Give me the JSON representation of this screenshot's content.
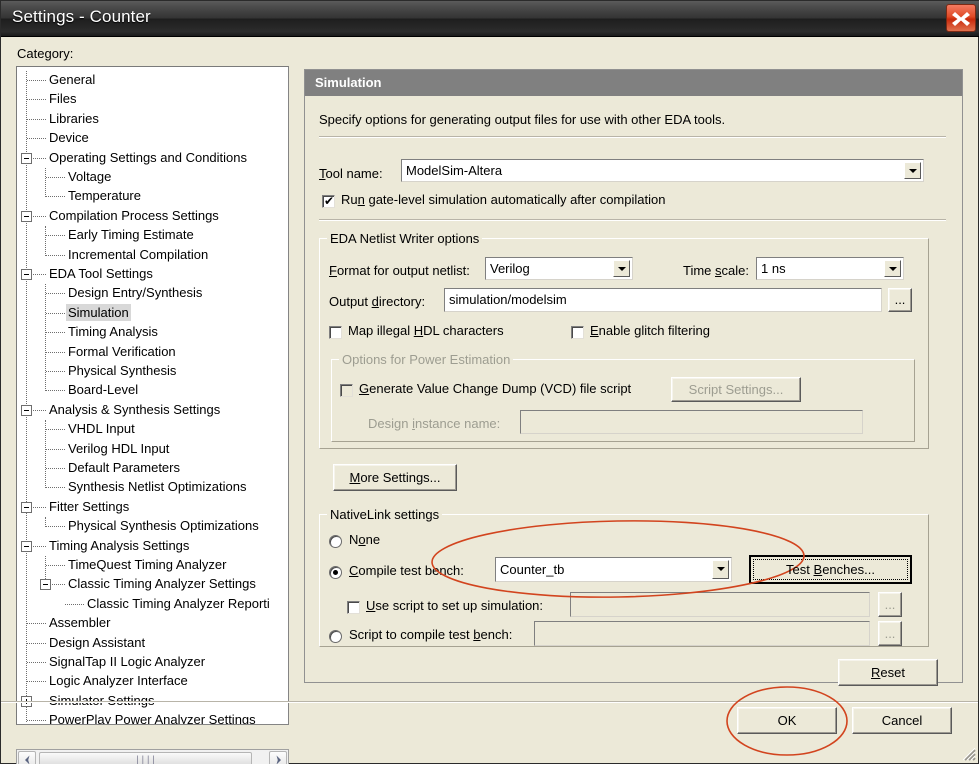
{
  "window": {
    "title": "Settings - Counter",
    "close_icon": "close-icon"
  },
  "sidebar": {
    "label": "Category:",
    "items": [
      {
        "label": "General",
        "depth": 1,
        "expander": null,
        "selected": false
      },
      {
        "label": "Files",
        "depth": 1,
        "expander": null,
        "selected": false
      },
      {
        "label": "Libraries",
        "depth": 1,
        "expander": null,
        "selected": false
      },
      {
        "label": "Device",
        "depth": 1,
        "expander": null,
        "selected": false
      },
      {
        "label": "Operating Settings and Conditions",
        "depth": 1,
        "expander": "minus",
        "selected": false
      },
      {
        "label": "Voltage",
        "depth": 2,
        "expander": null,
        "selected": false
      },
      {
        "label": "Temperature",
        "depth": 2,
        "expander": null,
        "selected": false
      },
      {
        "label": "Compilation Process Settings",
        "depth": 1,
        "expander": "minus",
        "selected": false
      },
      {
        "label": "Early Timing Estimate",
        "depth": 2,
        "expander": null,
        "selected": false
      },
      {
        "label": "Incremental Compilation",
        "depth": 2,
        "expander": null,
        "selected": false
      },
      {
        "label": "EDA Tool Settings",
        "depth": 1,
        "expander": "minus",
        "selected": false
      },
      {
        "label": "Design Entry/Synthesis",
        "depth": 2,
        "expander": null,
        "selected": false
      },
      {
        "label": "Simulation",
        "depth": 2,
        "expander": null,
        "selected": true
      },
      {
        "label": "Timing Analysis",
        "depth": 2,
        "expander": null,
        "selected": false
      },
      {
        "label": "Formal Verification",
        "depth": 2,
        "expander": null,
        "selected": false
      },
      {
        "label": "Physical Synthesis",
        "depth": 2,
        "expander": null,
        "selected": false
      },
      {
        "label": "Board-Level",
        "depth": 2,
        "expander": null,
        "selected": false
      },
      {
        "label": "Analysis & Synthesis Settings",
        "depth": 1,
        "expander": "minus",
        "selected": false
      },
      {
        "label": "VHDL Input",
        "depth": 2,
        "expander": null,
        "selected": false
      },
      {
        "label": "Verilog HDL Input",
        "depth": 2,
        "expander": null,
        "selected": false
      },
      {
        "label": "Default Parameters",
        "depth": 2,
        "expander": null,
        "selected": false
      },
      {
        "label": "Synthesis Netlist Optimizations",
        "depth": 2,
        "expander": null,
        "selected": false
      },
      {
        "label": "Fitter Settings",
        "depth": 1,
        "expander": "minus",
        "selected": false
      },
      {
        "label": "Physical Synthesis Optimizations",
        "depth": 2,
        "expander": null,
        "selected": false
      },
      {
        "label": "Timing Analysis Settings",
        "depth": 1,
        "expander": "minus",
        "selected": false
      },
      {
        "label": "TimeQuest Timing Analyzer",
        "depth": 2,
        "expander": null,
        "selected": false
      },
      {
        "label": "Classic Timing Analyzer Settings",
        "depth": 2,
        "expander": "minus",
        "selected": false
      },
      {
        "label": "Classic Timing Analyzer Reporti",
        "depth": 3,
        "expander": null,
        "selected": false
      },
      {
        "label": "Assembler",
        "depth": 1,
        "expander": null,
        "selected": false
      },
      {
        "label": "Design Assistant",
        "depth": 1,
        "expander": null,
        "selected": false
      },
      {
        "label": "SignalTap II Logic Analyzer",
        "depth": 1,
        "expander": null,
        "selected": false
      },
      {
        "label": "Logic Analyzer Interface",
        "depth": 1,
        "expander": null,
        "selected": false
      },
      {
        "label": "Simulator Settings",
        "depth": 1,
        "expander": "plus",
        "selected": false
      },
      {
        "label": "PowerPlay Power Analyzer Settings",
        "depth": 1,
        "expander": null,
        "selected": false
      }
    ],
    "scrollbar": {
      "left_icon": "chevron-left-icon",
      "right_icon": "chevron-right-icon",
      "grip_icon": "grip-dots-icon"
    }
  },
  "panel": {
    "header": "Simulation",
    "description": "Specify options for generating output files for use with other EDA tools.",
    "tool_name_label": "Tool name:",
    "tool_name_value": "ModelSim-Altera",
    "run_gatelevel_label": "Run gate-level simulation automatically after compilation",
    "run_gatelevel_checked": true
  },
  "netlist_group": {
    "title": "EDA Netlist Writer options",
    "format_label": "Format for output netlist:",
    "format_value": "Verilog",
    "timescale_label": "Time scale:",
    "timescale_value": "1 ns",
    "output_dir_label": "Output directory:",
    "output_dir_value": "simulation/modelsim",
    "browse_label": "...",
    "map_illegal_label": "Map illegal HDL characters",
    "map_illegal_checked": false,
    "enable_glitch_label": "Enable glitch filtering",
    "enable_glitch_checked": false
  },
  "power_group": {
    "title": "Options for Power Estimation",
    "vcd_label": "Generate Value Change Dump (VCD) file script",
    "vcd_checked": false,
    "script_settings_label": "Script Settings...",
    "design_instance_label": "Design instance name:",
    "design_instance_value": ""
  },
  "more_settings_label": "More Settings...",
  "nativelink_group": {
    "title": "NativeLink settings",
    "none_label": "None",
    "none_selected": false,
    "compile_tb_label": "Compile test bench:",
    "compile_tb_selected": true,
    "compile_tb_value": "Counter_tb",
    "test_benches_label": "Test Benches...",
    "use_script_label": "Use script to set up simulation:",
    "use_script_checked": false,
    "use_script_value": "",
    "use_script_browse": "...",
    "script_compile_label": "Script to compile test bench:",
    "script_compile_selected": false,
    "script_compile_value": "",
    "script_compile_browse": "..."
  },
  "footer": {
    "reset_label": "Reset",
    "ok_label": "OK",
    "cancel_label": "Cancel"
  },
  "annotations": {
    "ellipse_color": "#d2441e",
    "nativelink_highlight": "compile-test-bench-row",
    "ok_highlight": "ok-button"
  }
}
